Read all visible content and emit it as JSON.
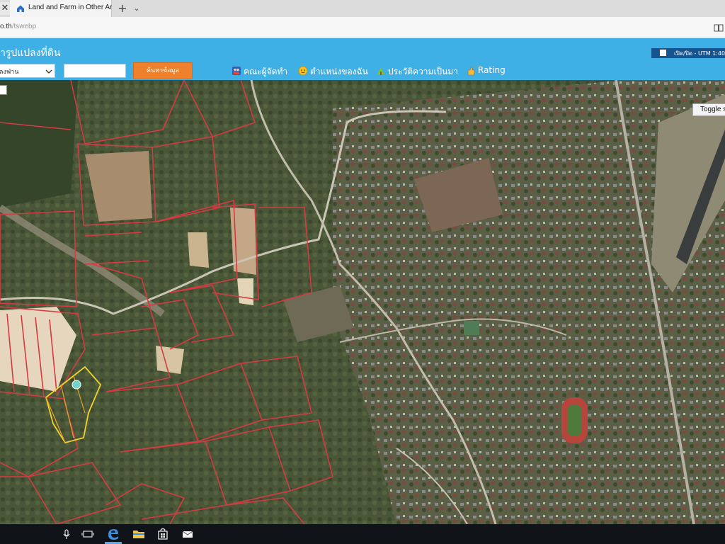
{
  "browser": {
    "tab_title": "Land and Farm in Other Are",
    "tab_close_glyph": "✕",
    "new_tab_glyph": "+",
    "tab_list_glyph": "⌄",
    "url_host": "o.th",
    "url_path": "/tswebp"
  },
  "header": {
    "title": "ารูปแปลงที่ดิน",
    "province_value": "ลงฟ่าน",
    "search_value": "",
    "search_button_label": "ค้นหาข้อมูล",
    "nav": [
      {
        "label": "คณะผู้จัดทำ",
        "icon": "team-icon"
      },
      {
        "label": "ตำแหน่งของฉัน",
        "icon": "location-face-icon"
      },
      {
        "label": "ประวัติความเป็นมา",
        "icon": "history-icon"
      },
      {
        "label": "Rating",
        "icon": "rating-icon"
      }
    ],
    "coord_label": "เปิด/ปิด - UTM 1:40"
  },
  "map": {
    "toggle_label": "Toggle s",
    "colors": {
      "parcel_border": "#d63a44",
      "selected_parcel": "#f2d22e",
      "header_bg": "#3fb0e6",
      "search_button": "#f0812c"
    }
  },
  "taskbar": {
    "icons": [
      "microphone-icon",
      "task-view-icon",
      "edge-icon",
      "file-explorer-icon",
      "store-icon",
      "mail-icon"
    ]
  }
}
